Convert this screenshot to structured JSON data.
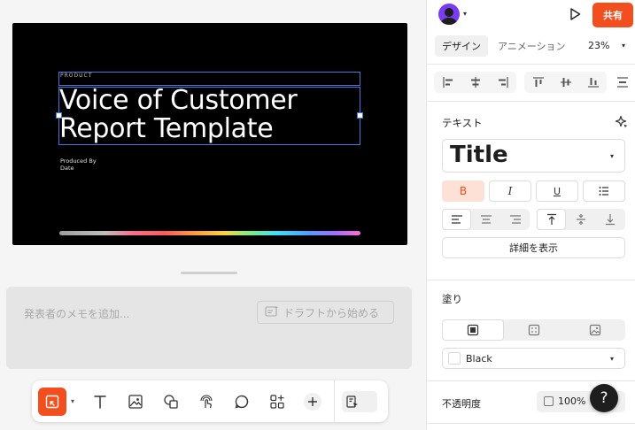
{
  "slide": {
    "product_label": "PRODUCT",
    "title_line1": "Voice of Customer",
    "title_line2": "Report Template",
    "produced_by": "Produced By",
    "date": "Date"
  },
  "notes": {
    "placeholder": "発表者のメモを追加...",
    "draft_button": "ドラフトから始める"
  },
  "toolbar": {
    "tools": [
      "frame-tool",
      "text-tool",
      "image-tool",
      "shape-tool",
      "draw-tool",
      "comment-tool",
      "widgets-tool",
      "add-tool"
    ]
  },
  "header": {
    "share_label": "共有"
  },
  "tabs": {
    "design": "デザイン",
    "animation": "アニメーション",
    "zoom": "23%"
  },
  "text_section": {
    "title": "テキスト",
    "font": "Title",
    "bold": "B",
    "italic": "I",
    "underline": "U",
    "details_button": "詳細を表示"
  },
  "fill_section": {
    "title": "塗り",
    "color_name": "Black",
    "color_hex": "#000000"
  },
  "opacity": {
    "label": "不透明度",
    "value": "100%"
  },
  "help": {
    "label": "?"
  },
  "colors": {
    "accent": "#f24e1e",
    "selection": "#3b7be0"
  }
}
